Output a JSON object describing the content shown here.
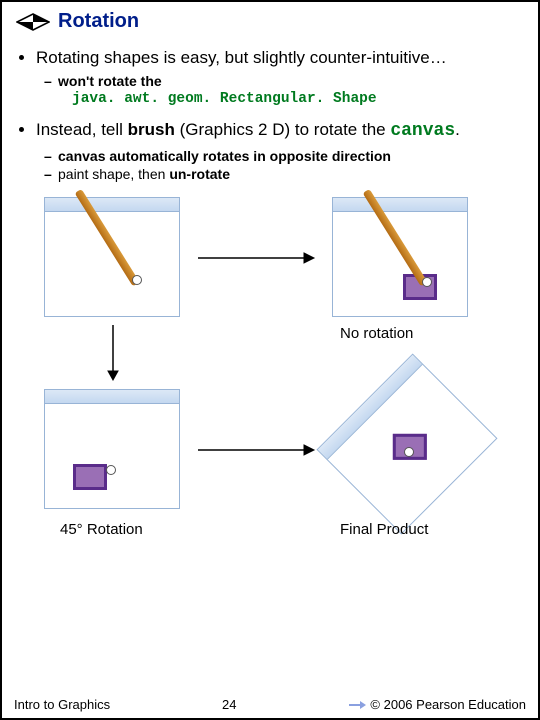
{
  "title": "Rotation",
  "bullets": {
    "b1": "Rotating shapes is easy, but slightly counter-intuitive…",
    "b1_sub1": "won't rotate the",
    "b1_code": "java. awt. geom. Rectangular. Shape",
    "b2_pre": "Instead, tell ",
    "b2_brush": "brush",
    "b2_mid": " (Graphics 2 D) to rotate the ",
    "b2_canvas": "canvas",
    "b2_post": ".",
    "b2_sub1": "canvas automatically rotates in opposite direction",
    "b2_sub2_a": "paint shape, ",
    "b2_sub2_b": "then ",
    "b2_sub2_c": "un-rotate"
  },
  "captions": {
    "no_rotation": "No rotation",
    "rot45": "45° Rotation",
    "final": "Final Product"
  },
  "footer": {
    "left": "Intro to Graphics",
    "center": "24",
    "right": "© 2006 Pearson Education"
  }
}
